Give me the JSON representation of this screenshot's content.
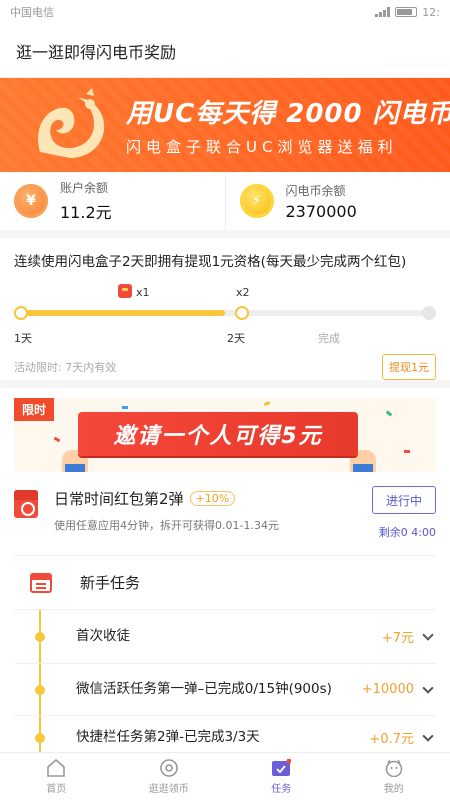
{
  "statusbar": {
    "carrier": "中国电信",
    "time": "12:"
  },
  "topbar": {
    "title": "逛一逛即得闪电币奖励"
  },
  "banner": {
    "line1": "用UC每天得 2000 闪电币",
    "line2": "闪电盒子联合UC浏览器送福利"
  },
  "balances": {
    "account": {
      "label": "账户余额",
      "value": "11.2元",
      "icon": "yuan-coin-icon"
    },
    "flash": {
      "label": "闪电币余额",
      "value": "2370000",
      "icon": "lightning-coin-icon"
    }
  },
  "progress": {
    "title": "连续使用闪电盒子2天即拥有提现1元资格(每天最少完成两个红包)",
    "fill_fraction": 0.5,
    "marks": [
      {
        "label": "1天",
        "reward": ""
      },
      {
        "label": "2天",
        "reward": "x2"
      },
      {
        "label": "完成",
        "reward": ""
      }
    ],
    "mid_reward": "x1",
    "limit_text": "活动限时: 7天内有效",
    "withdraw_label": "提现1元"
  },
  "invite": {
    "tag": "限时",
    "text": "邀请一个人可得5元"
  },
  "redpacket": {
    "title": "日常时间红包第2弹",
    "badge": "+10%",
    "desc": "使用任意应用4分钟，拆开可获得0.01-1.34元",
    "button": "进行中",
    "remaining": "剩余0 4:00"
  },
  "newbie": {
    "title": "新手任务"
  },
  "tasks": [
    {
      "name": "首次收徒",
      "reward": "+7元"
    },
    {
      "name": "微信活跃任务第一弹–已完成0/15钟(900s)",
      "reward": "+10000"
    },
    {
      "name": "快捷栏任务第2弹-已完成3/3天",
      "reward": "+0.7元"
    }
  ],
  "tabbar": [
    {
      "label": "首页",
      "icon": "home-icon"
    },
    {
      "label": "逛逛领币",
      "icon": "eye-icon"
    },
    {
      "label": "任务",
      "icon": "task-icon"
    },
    {
      "label": "我的",
      "icon": "profile-icon"
    }
  ],
  "colors": {
    "brand_orange": "#ff6a25",
    "accent_purple": "#6b5fd8",
    "progress_yellow": "#f9c63b"
  }
}
